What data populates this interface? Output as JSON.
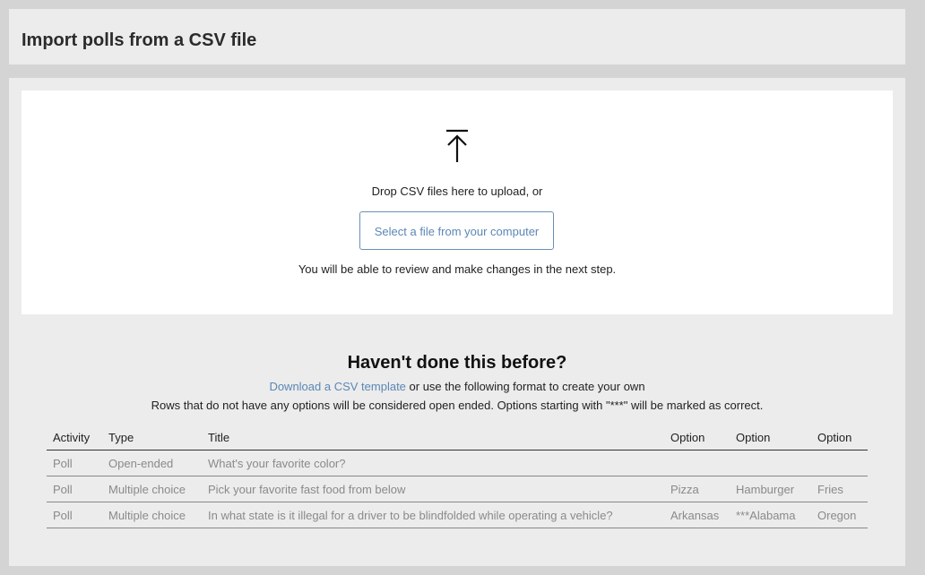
{
  "page": {
    "title": "Import polls from a CSV file"
  },
  "dropzone": {
    "icon": "upload-arrow-icon",
    "drop_text": "Drop CSV files here to upload, or",
    "select_button": "Select a file from your computer",
    "review_text": "You will be able to review and make changes in the next step."
  },
  "help": {
    "title": "Haven't done this before?",
    "template_link": "Download a CSV template",
    "format_text": " or use the following format to create your own",
    "rules_text": "Rows that do not have any options will be considered open ended. Options starting with \"***\" will be marked as correct."
  },
  "table": {
    "headers": [
      "Activity",
      "Type",
      "Title",
      "Option",
      "Option",
      "Option"
    ],
    "rows": [
      [
        "Poll",
        "Open-ended",
        "What's your favorite color?",
        "",
        "",
        ""
      ],
      [
        "Poll",
        "Multiple choice",
        "Pick your favorite fast food from below",
        "Pizza",
        "Hamburger",
        "Fries"
      ],
      [
        "Poll",
        "Multiple choice",
        "In what state is it illegal for a driver to be blindfolded while operating a vehicle?",
        "Arkansas",
        "***Alabama",
        "Oregon"
      ]
    ]
  },
  "colors": {
    "accent": "#5b87b5",
    "panel": "#ececec",
    "background": "#d4d4d4"
  }
}
